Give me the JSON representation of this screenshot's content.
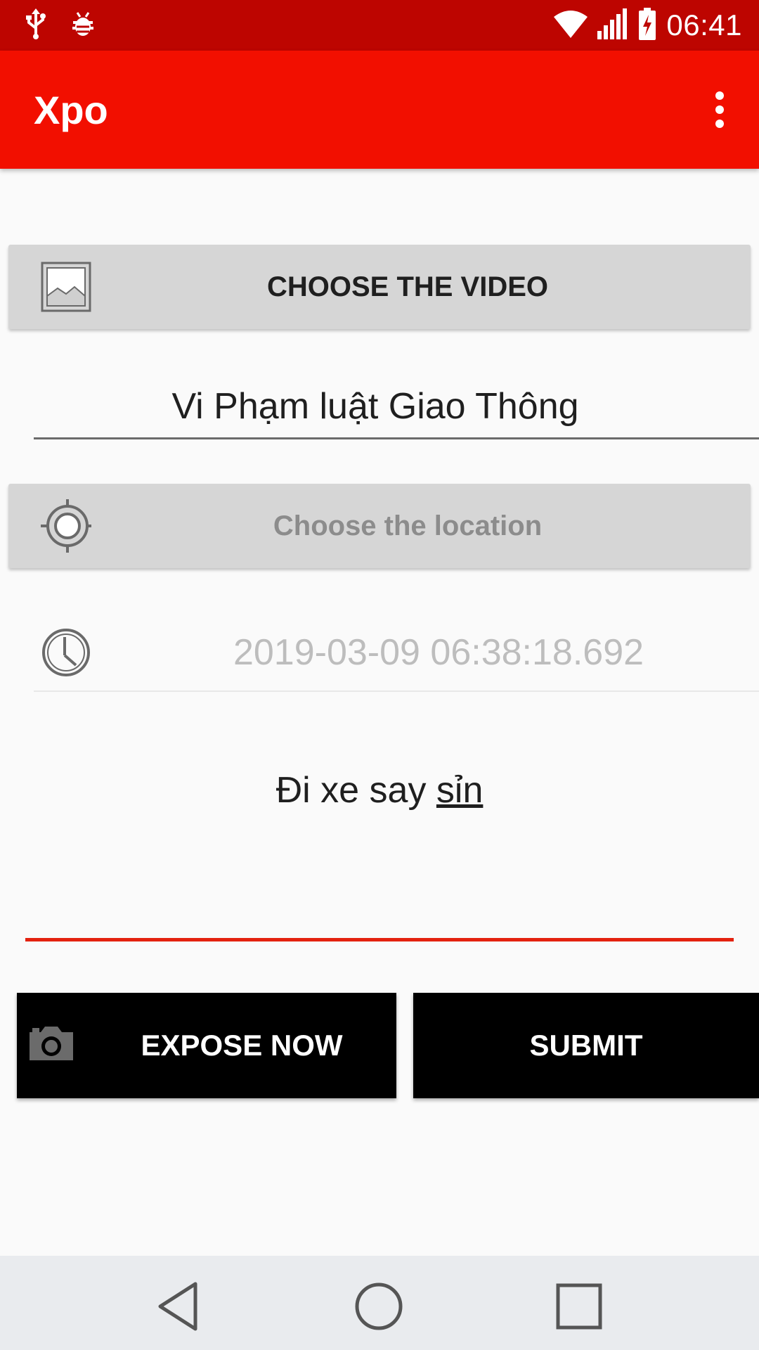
{
  "status_bar": {
    "time": "06:41",
    "icons": [
      "usb-icon",
      "bug-icon",
      "wifi-icon",
      "signal-icon",
      "battery-charging-icon"
    ]
  },
  "app_bar": {
    "title": "Xpo",
    "menu_icon": "more-vert-icon"
  },
  "form": {
    "choose_video_label": "CHOOSE THE VIDEO",
    "title_value": "Vi Phạm luật Giao Thông",
    "choose_location_label": "Choose the location",
    "datetime_value": "2019-03-09 06:38:18.692",
    "description_value_main": "Đi xe say ",
    "description_value_underlined": "sỉn"
  },
  "actions": {
    "expose_label": "EXPOSE NOW",
    "submit_label": "SUBMIT"
  },
  "colors": {
    "status_bar": "#bd0500",
    "app_bar": "#f20f00",
    "accent_underline": "#e3220f",
    "grey_button": "#d6d6d6",
    "black_button": "#000000"
  },
  "nav_bar": {
    "buttons": [
      "back-icon",
      "home-icon",
      "recents-icon"
    ]
  }
}
